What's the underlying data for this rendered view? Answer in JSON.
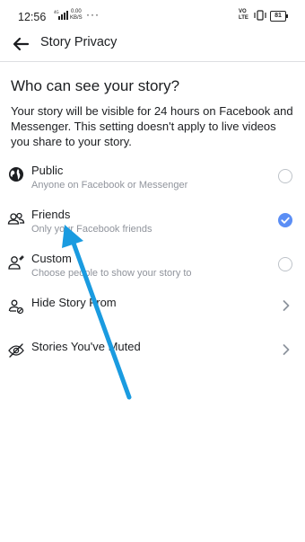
{
  "status_bar": {
    "time": "12:56",
    "speed_value": "0.00",
    "speed_unit": "KB/S",
    "network": "4G",
    "volte_top": "VO",
    "volte_bottom": "LTE",
    "battery": "81"
  },
  "header": {
    "title": "Story Privacy",
    "back_icon": "arrow-left-icon"
  },
  "main": {
    "heading": "Who can see your story?",
    "description": "Your story will be visible for 24 hours on Facebook and Messenger. This setting doesn't apply to live videos you share to your story.",
    "options": [
      {
        "label": "Public",
        "subtitle": "Anyone on Facebook or Messenger",
        "icon": "globe-icon",
        "selected": false
      },
      {
        "label": "Friends",
        "subtitle": "Only your Facebook friends",
        "icon": "friends-icon",
        "selected": true
      },
      {
        "label": "Custom",
        "subtitle": "Choose people to show your story to",
        "icon": "custom-person-icon",
        "selected": false
      }
    ],
    "links": [
      {
        "label": "Hide Story From",
        "icon": "hide-people-icon"
      },
      {
        "label": "Stories You've Muted",
        "icon": "eye-slash-icon"
      }
    ]
  },
  "colors": {
    "accent": "#5b8ef5",
    "annotation_arrow": "#1a9be0",
    "subtitle_text": "#90949c",
    "divider": "#dddfe2"
  }
}
